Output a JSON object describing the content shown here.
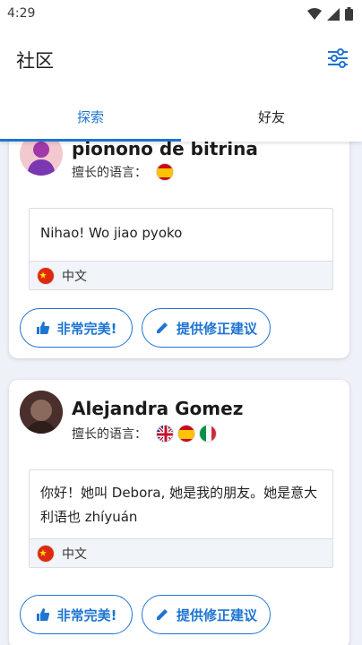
{
  "status": {
    "time": "4:29"
  },
  "header": {
    "title": "社区",
    "filter_icon": "tune-icon"
  },
  "tabs": [
    {
      "label": "探索",
      "active": true
    },
    {
      "label": "好友",
      "active": false
    }
  ],
  "accent_color": "#1e74d2",
  "posts": [
    {
      "author": "pionono de bitrina",
      "langs_label": "擅长的语言：",
      "langs": [
        "spanish-flag"
      ],
      "text": "Nihao! Wo jiao pyoko",
      "post_lang": "中文",
      "btn_perfect": "非常完美!",
      "btn_correct": "提供修正建议"
    },
    {
      "author": "Alejandra Gomez",
      "langs_label": "擅长的语言：",
      "langs": [
        "uk-flag",
        "spanish-flag",
        "italian-flag"
      ],
      "text": "你好！她叫 Debora, 她是我的朋友。她是意大利语也 zhíyuán",
      "post_lang": "中文",
      "btn_perfect": "非常完美!",
      "btn_correct": "提供修正建议"
    }
  ]
}
